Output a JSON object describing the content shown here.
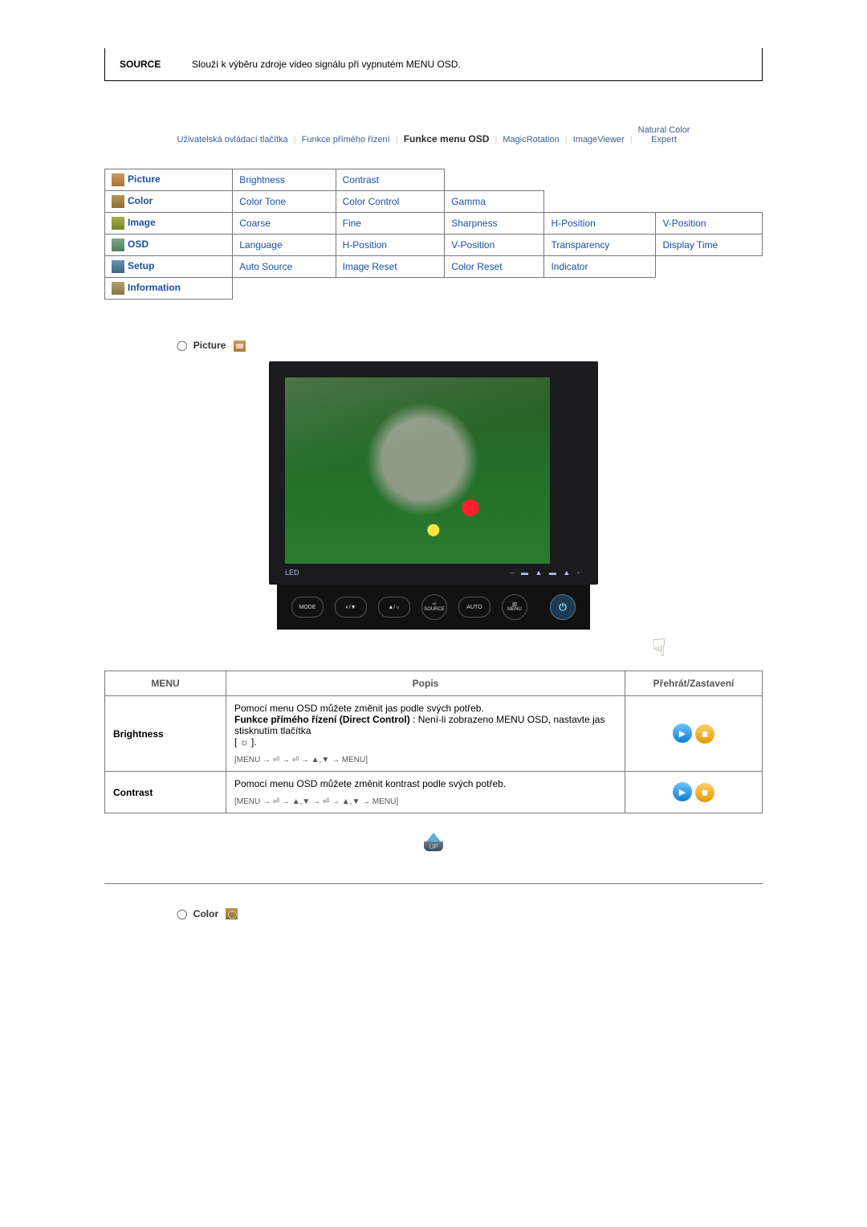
{
  "source": {
    "label": "SOURCE",
    "desc": "Slouží k výběru zdroje video signálu při vypnutém MENU OSD."
  },
  "breadcrumb": {
    "items": [
      "Uživatelská ovládací tlačítka",
      "Funkce přímého řízení",
      "Funkce menu OSD",
      "MagicRotation",
      "ImageViewer",
      "Natural Color\nExpert"
    ],
    "active_index": 2
  },
  "menu": {
    "rows": [
      {
        "cat": "Picture",
        "items": [
          "Brightness",
          "Contrast",
          "",
          "",
          ""
        ]
      },
      {
        "cat": "Color",
        "items": [
          "Color Tone",
          "Color Control",
          "Gamma",
          "",
          ""
        ]
      },
      {
        "cat": "Image",
        "items": [
          "Coarse",
          "Fine",
          "Sharpness",
          "H-Position",
          "V-Position"
        ]
      },
      {
        "cat": "OSD",
        "items": [
          "Language",
          "H-Position",
          "V-Position",
          "Transparency",
          "Display Time"
        ]
      },
      {
        "cat": "Setup",
        "items": [
          "Auto Source",
          "Image Reset",
          "Color Reset",
          "Indicator",
          ""
        ]
      },
      {
        "cat": "Information",
        "items": [
          "",
          "",
          "",
          "",
          ""
        ]
      }
    ]
  },
  "section_picture": {
    "title": "Picture",
    "monitor": {
      "led": "LED",
      "buttons": [
        "MODE",
        "◐/▼",
        "▲/☼",
        "⏎\nSOURCE",
        "AUTO",
        "▥\nMENU"
      ],
      "power": "⏻"
    }
  },
  "desc_table": {
    "headers": {
      "menu": "MENU",
      "popis": "Popis",
      "play": "Přehrát/Zastavení"
    },
    "rows": [
      {
        "menu": "Brightness",
        "popis_lines": [
          "Pomocí menu OSD můžete změnit jas podle svých potřeb.",
          "<b>Funkce přímého řízení (Direct Control)</b> : Není-li zobrazeno MENU OSD, nastavte jas stisknutím tlačítka",
          "[ ☼ ]."
        ],
        "path": "[MENU → ⏎ → ⏎ → ▲,▼ → MENU]"
      },
      {
        "menu": "Contrast",
        "popis_lines": [
          "Pomocí menu OSD můžete změnit kontrast podle svých potřeb."
        ],
        "path": "[MENU → ⏎ → ▲,▼ → ⏎ → ▲,▼ → MENU]"
      }
    ]
  },
  "up": {
    "label": "UP"
  },
  "section_color": {
    "title": "Color"
  }
}
